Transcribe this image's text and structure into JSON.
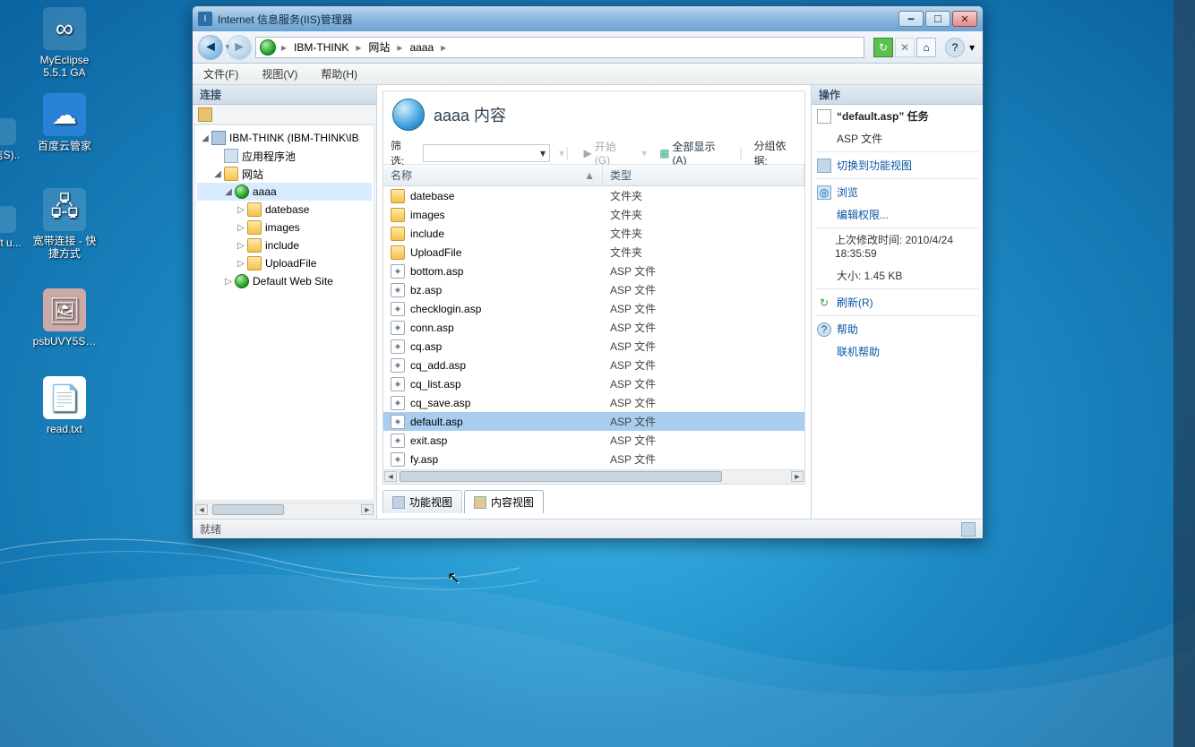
{
  "window": {
    "title": "Internet 信息服务(IIS)管理器",
    "breadcrumb": [
      "IBM-THINK",
      "网站",
      "aaaa"
    ],
    "menu": {
      "file": "文件(F)",
      "view": "视图(V)",
      "help": "帮助(H)"
    },
    "statusbar": "就绪"
  },
  "panels": {
    "connections": "连接",
    "actions": "操作"
  },
  "tree": {
    "root": "IBM-THINK (IBM-THINK\\IB",
    "pools": "应用程序池",
    "sites": "网站",
    "site_aaaa": "aaaa",
    "sub": {
      "datebase": "datebase",
      "images": "images",
      "include": "include",
      "uploadfile": "UploadFile"
    },
    "defaultsite": "Default Web Site"
  },
  "content": {
    "heading": "aaaa 内容",
    "filter_label": "筛选:",
    "start": "开始(G)",
    "showall": "全部显示(A)",
    "groupby": "分组依据:",
    "col_name": "名称",
    "col_type": "类型",
    "items": [
      {
        "name": "datebase",
        "type": "文件夹",
        "kind": "folder"
      },
      {
        "name": "images",
        "type": "文件夹",
        "kind": "folder"
      },
      {
        "name": "include",
        "type": "文件夹",
        "kind": "folder"
      },
      {
        "name": "UploadFile",
        "type": "文件夹",
        "kind": "folder"
      },
      {
        "name": "bottom.asp",
        "type": "ASP 文件",
        "kind": "asp"
      },
      {
        "name": "bz.asp",
        "type": "ASP 文件",
        "kind": "asp"
      },
      {
        "name": "checklogin.asp",
        "type": "ASP 文件",
        "kind": "asp"
      },
      {
        "name": "conn.asp",
        "type": "ASP 文件",
        "kind": "asp"
      },
      {
        "name": "cq.asp",
        "type": "ASP 文件",
        "kind": "asp"
      },
      {
        "name": "cq_add.asp",
        "type": "ASP 文件",
        "kind": "asp"
      },
      {
        "name": "cq_list.asp",
        "type": "ASP 文件",
        "kind": "asp"
      },
      {
        "name": "cq_save.asp",
        "type": "ASP 文件",
        "kind": "asp"
      },
      {
        "name": "default.asp",
        "type": "ASP 文件",
        "kind": "asp",
        "selected": true
      },
      {
        "name": "exit.asp",
        "type": "ASP 文件",
        "kind": "asp"
      },
      {
        "name": "fy.asp",
        "type": "ASP 文件",
        "kind": "asp"
      }
    ],
    "tabs": {
      "features": "功能视图",
      "content": "内容视图"
    }
  },
  "actions": {
    "task_title": "“default.asp” 任务",
    "aspfile": "ASP 文件",
    "switchview": "切换到功能视图",
    "browse": "浏览",
    "editperm": "编辑权限...",
    "lastmod": "上次修改时间: 2010/4/24 18:35:59",
    "size": "大小: 1.45 KB",
    "refresh": "刷新(R)",
    "help": "帮助",
    "onlinehelp": "联机帮助"
  },
  "desktop": {
    "myeclipse": "MyEclipse 5.5.1 GA",
    "baidu": "百度云管家",
    "broadband": "宽带连接 - 快捷方式",
    "psb": "psbUVY5S…",
    "read": "read.txt",
    "left_partial1": "信S)..",
    "left_partial2": "oft u..."
  }
}
